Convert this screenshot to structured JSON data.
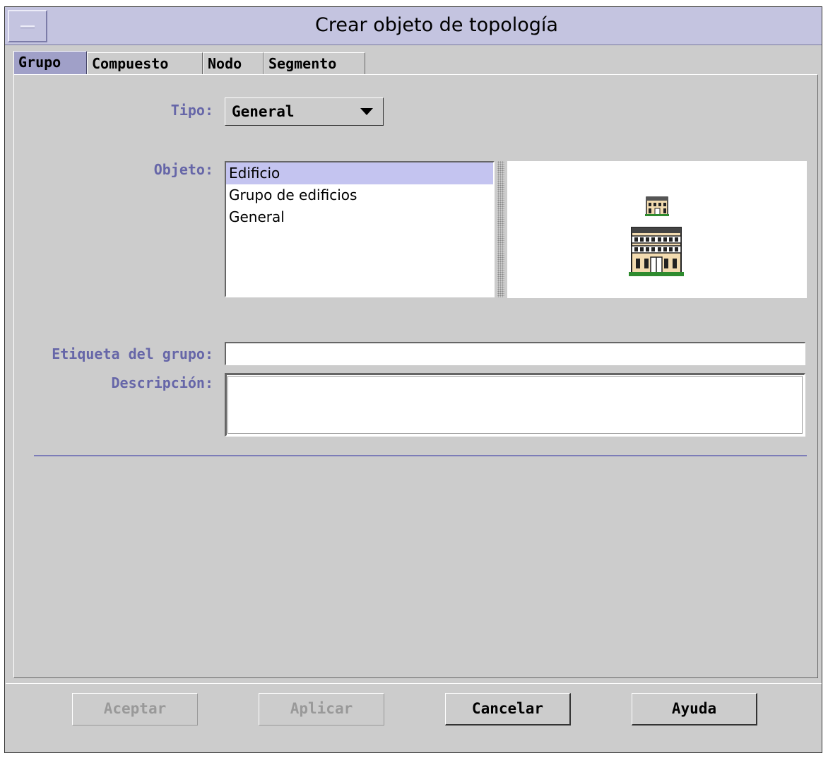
{
  "window": {
    "title": "Crear objeto de topología"
  },
  "tabs": [
    {
      "label": "Grupo",
      "active": true
    },
    {
      "label": "Compuesto",
      "active": false
    },
    {
      "label": "Nodo",
      "active": false
    },
    {
      "label": "Segmento",
      "active": false
    }
  ],
  "form": {
    "tipo_label": "Tipo:",
    "tipo_value": "General",
    "objeto_label": "Objeto:",
    "objeto_items": [
      "Edificio",
      "Grupo de edificios",
      "General"
    ],
    "objeto_selected": "Edificio",
    "etiqueta_label": "Etiqueta del grupo:",
    "etiqueta_value": "",
    "descripcion_label": "Descripción:",
    "descripcion_value": ""
  },
  "preview": {
    "small_icon": "building-small-icon",
    "large_icon": "building-large-icon"
  },
  "buttons": {
    "accept_label": "Aceptar",
    "apply_label": "Aplicar",
    "cancel_label": "Cancelar",
    "help_label": "Ayuda"
  },
  "colors": {
    "title_bar": "#c4c4e0",
    "label_text": "#6666a8",
    "active_tab": "#a0a0c8",
    "selection": "#c4c4f0",
    "separator": "#7c7cb8"
  }
}
